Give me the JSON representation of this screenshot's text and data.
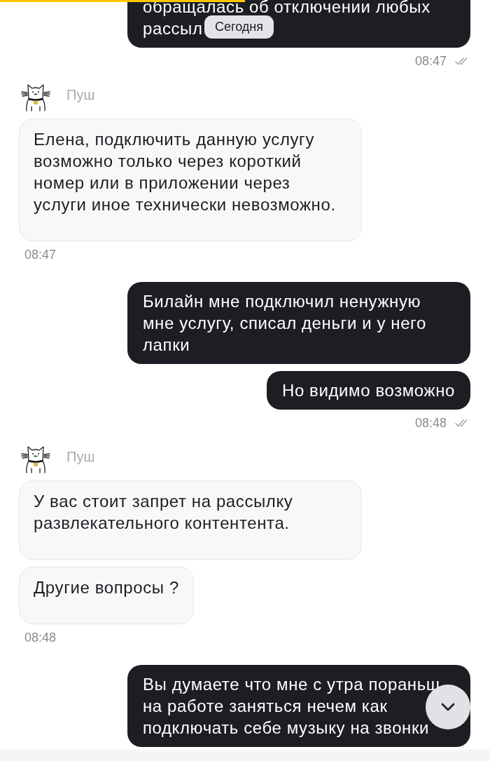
{
  "date_badge": "Сегодня",
  "messages": [
    {
      "kind": "outgoing",
      "text": "обращалась об отключении любых рассыл"
    },
    {
      "kind": "sent_time",
      "text": "08:47",
      "read": true
    },
    {
      "kind": "sender",
      "name": "Пуш"
    },
    {
      "kind": "incoming",
      "text": "Елена, подключить данную услугу возможно только через короткий номер или в приложении через услуги иное технически невозможно."
    },
    {
      "kind": "received_time",
      "text": "08:47"
    },
    {
      "kind": "outgoing",
      "text": "Билайн мне подключил ненужную мне услугу, списал деньги и у него лапки"
    },
    {
      "kind": "outgoing",
      "text": "Но видимо возможно"
    },
    {
      "kind": "sent_time",
      "text": "08:48",
      "read": true
    },
    {
      "kind": "sender",
      "name": "Пуш"
    },
    {
      "kind": "incoming",
      "text": "У вас стоит запрет на рассылку развлекательного контентента."
    },
    {
      "kind": "incoming",
      "text": "Другие вопросы ?"
    },
    {
      "kind": "received_time",
      "text": "08:48"
    },
    {
      "kind": "outgoing",
      "text": "Вы думаете что мне с утра пораньш на работе заняться нечем как подключать себе музыку на звонки"
    }
  ]
}
